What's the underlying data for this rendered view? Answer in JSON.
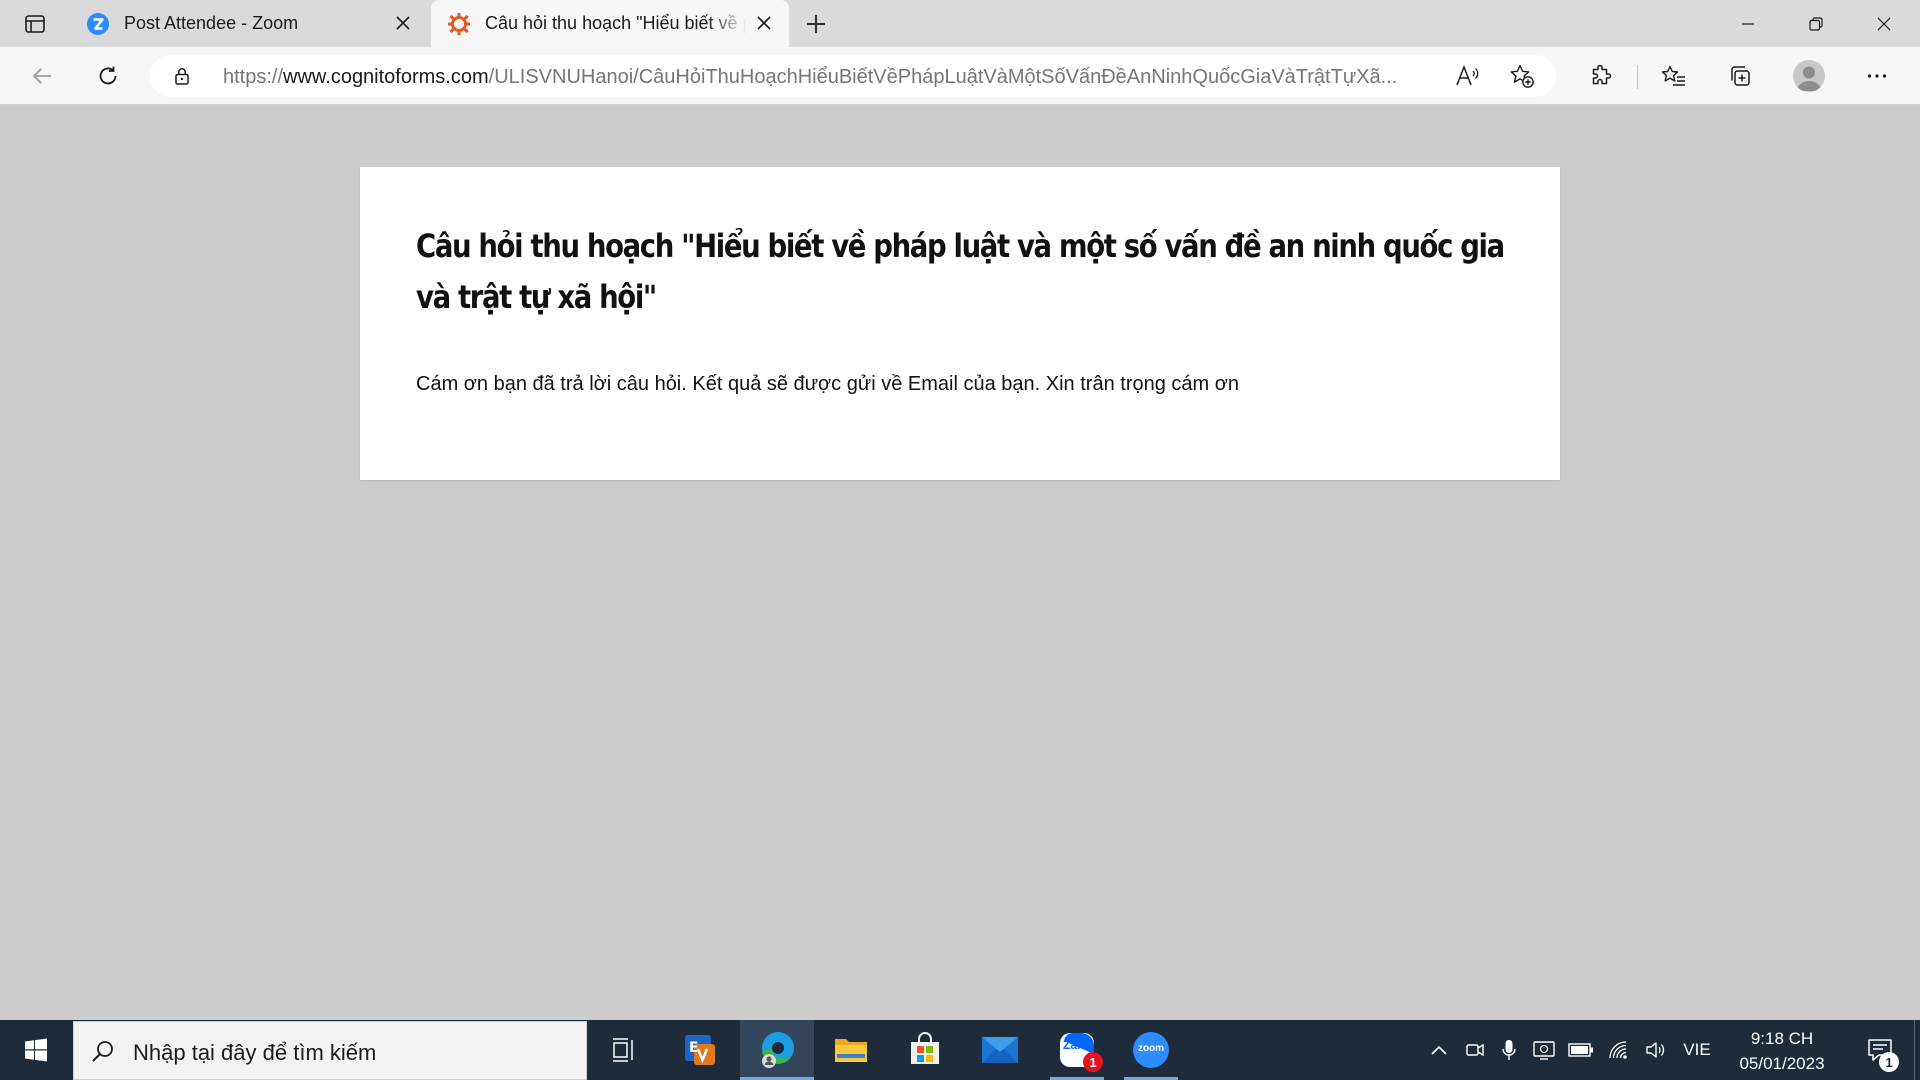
{
  "browser": {
    "tabs": [
      {
        "title": "Post Attendee - Zoom",
        "icon": "zoom-icon",
        "active": false
      },
      {
        "title": "Câu hỏi thu hoạch \"Hiểu biết về pháp luật",
        "icon": "cognito-forms-icon",
        "active": true
      }
    ],
    "url": {
      "scheme": "https://",
      "host": "www.cognitoforms.com",
      "path": "/ULISVNUHanoi/CâuHỏiThuHoạchHiểuBiếtVềPhápLuậtVàMộtSốVấnĐềAnNinhQuốcGiaVàTrậtTựXã..."
    }
  },
  "form": {
    "title": "Câu hỏi thu hoạch \"Hiểu biết về pháp luật và một số vấn đề an ninh quốc gia và trật tự xã hội\"",
    "confirmation": "Cám ơn bạn đã trả lời câu hỏi. Kết quả sẽ được gửi về Email của bạn. Xin trân trọng cám ơn"
  },
  "taskbar": {
    "search_placeholder": "Nhập tại đây để tìm kiếm",
    "apps": [
      {
        "name": "task-view",
        "icon": "task-view-icon"
      },
      {
        "name": "office-app",
        "icon": "office-app-icon"
      },
      {
        "name": "edge",
        "icon": "edge-icon",
        "active": true
      },
      {
        "name": "file-explorer",
        "icon": "folder-icon"
      },
      {
        "name": "microsoft-store",
        "icon": "store-icon"
      },
      {
        "name": "mail",
        "icon": "mail-icon"
      },
      {
        "name": "zalo",
        "icon": "zalo-icon",
        "badge": "1"
      },
      {
        "name": "zoom",
        "icon": "zoom-app-icon",
        "label": "zoom"
      }
    ],
    "zalo_label": "Zalo",
    "language": "VIE",
    "time": "9:18 CH",
    "date": "05/01/2023",
    "notification_count": "1"
  },
  "colors": {
    "page_background": "#cccccc",
    "card_background": "#ffffff",
    "taskbar": "#1d2b3a",
    "zoom_blue": "#2d8cff",
    "cognito_orange": "#e05a26"
  }
}
